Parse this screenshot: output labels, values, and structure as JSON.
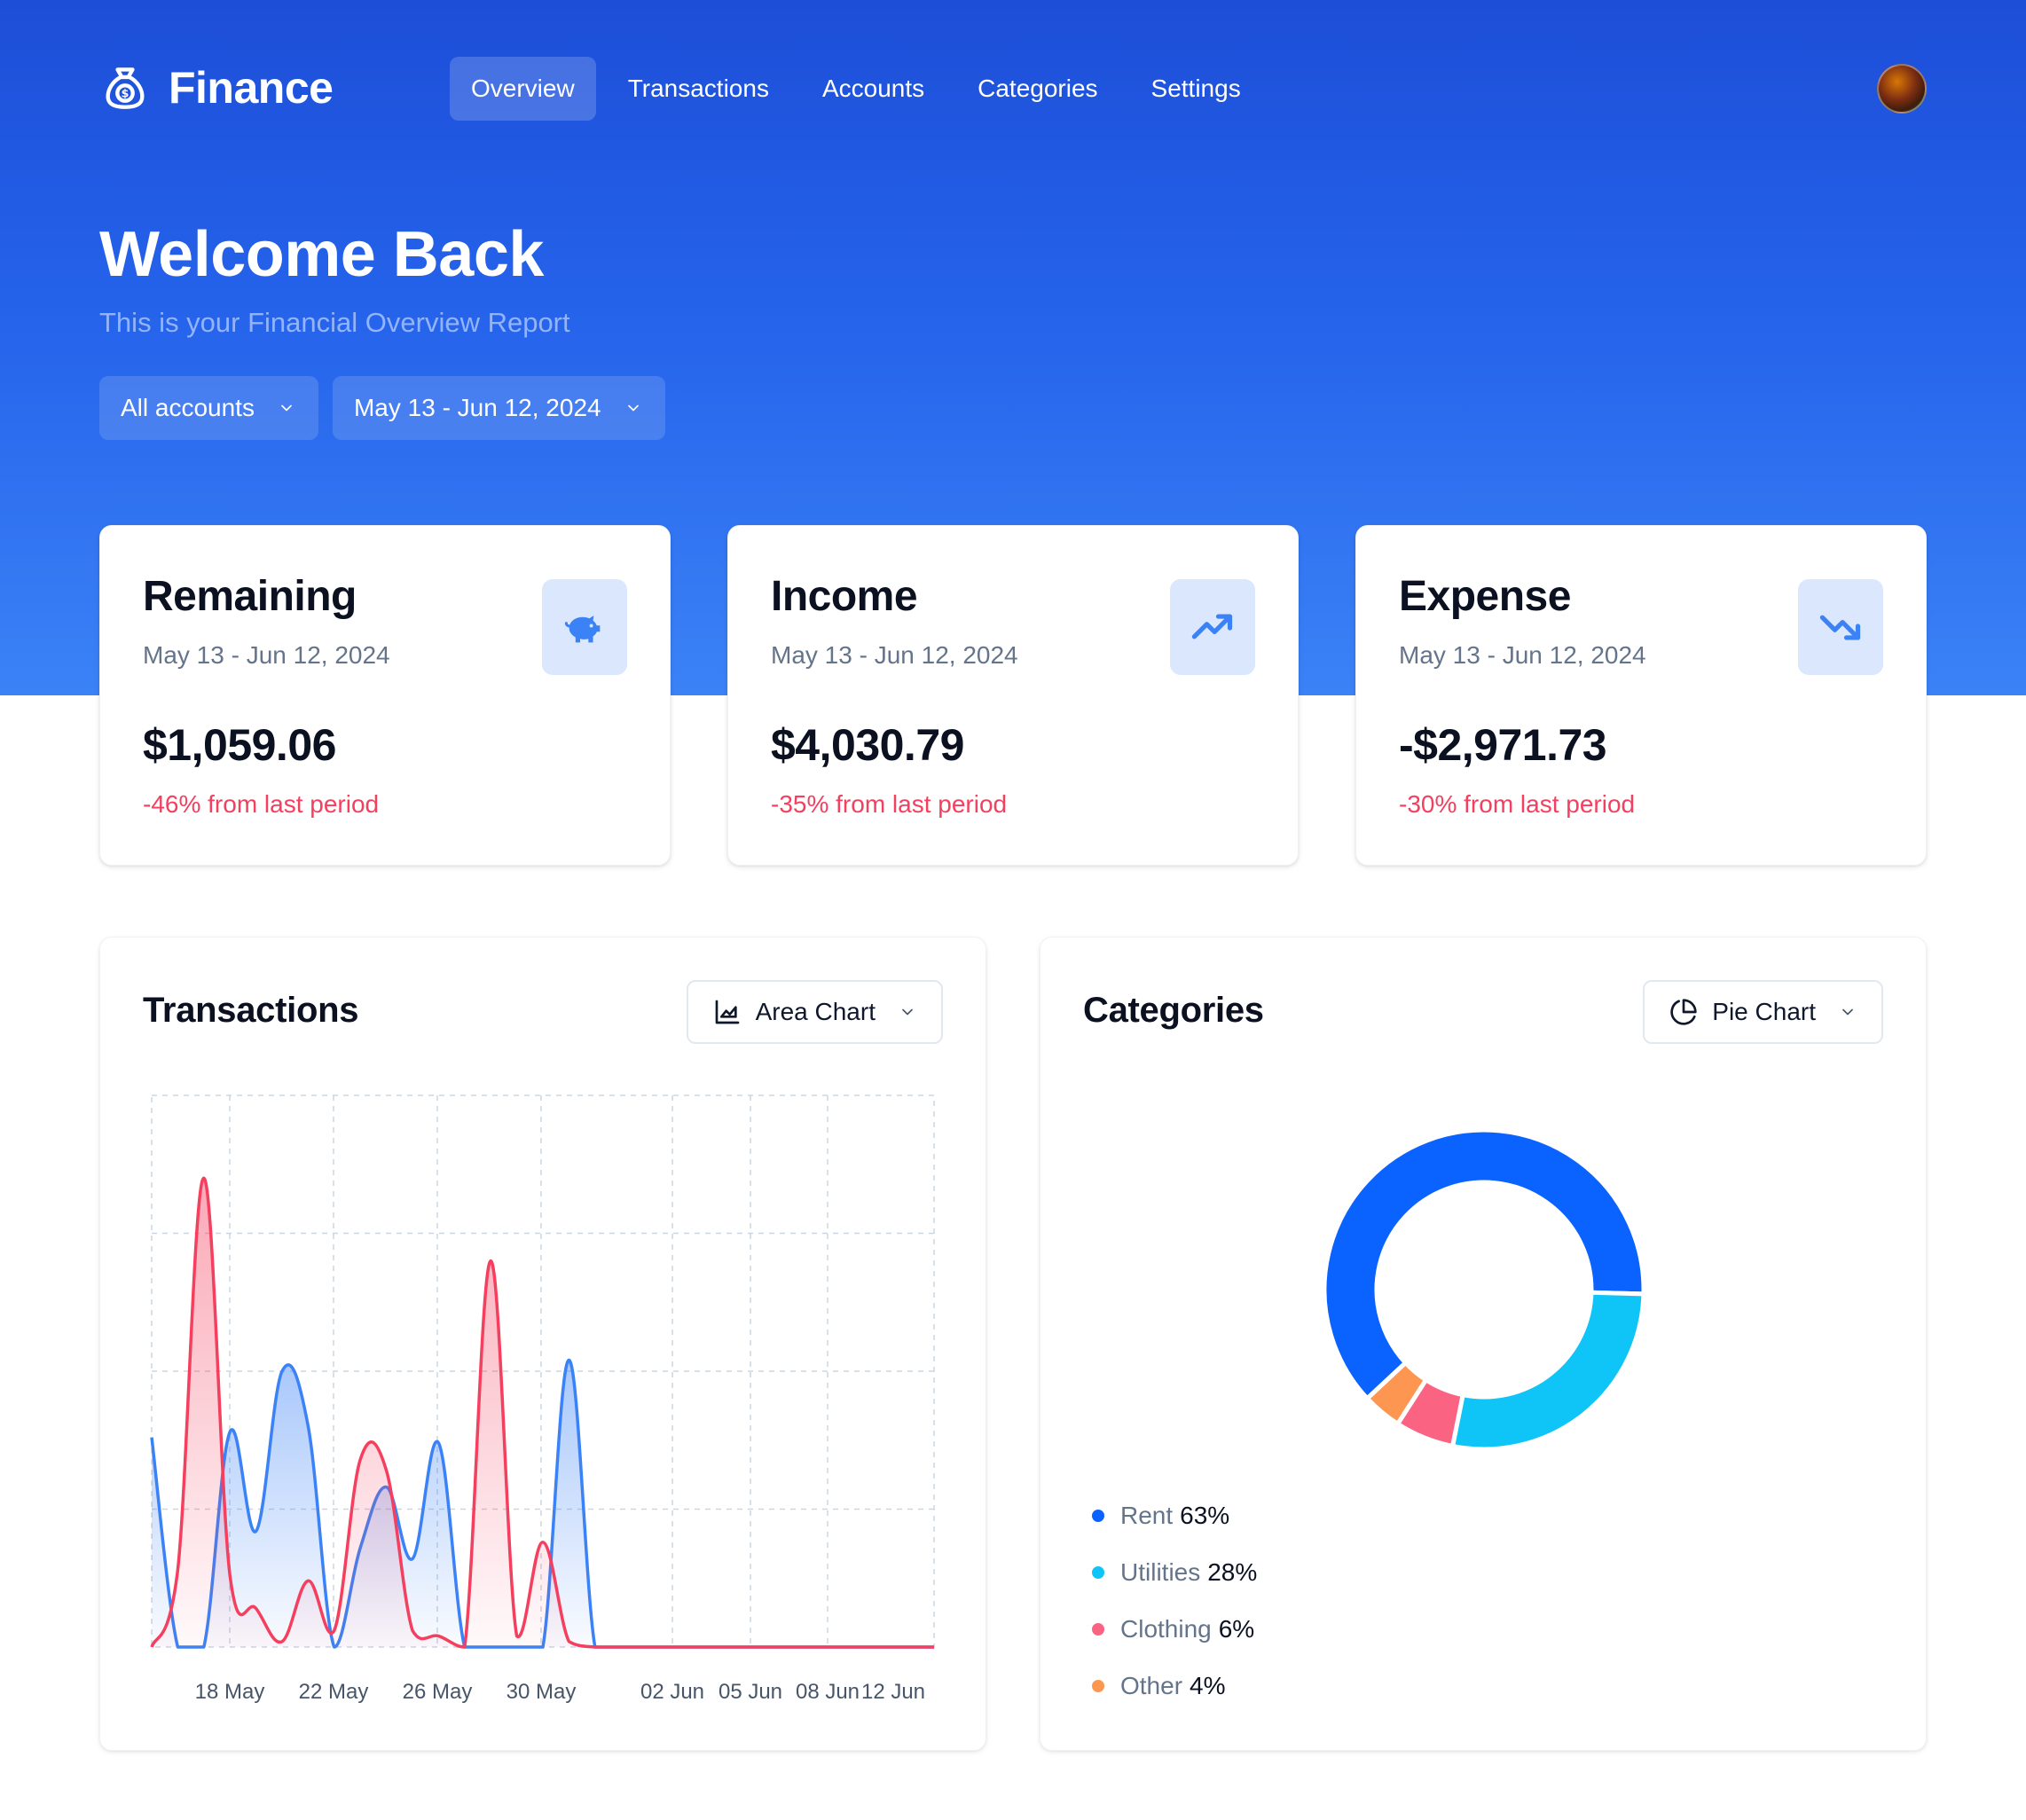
{
  "app": {
    "name": "Finance"
  },
  "nav": {
    "items": [
      {
        "label": "Overview",
        "active": true
      },
      {
        "label": "Transactions",
        "active": false
      },
      {
        "label": "Accounts",
        "active": false
      },
      {
        "label": "Categories",
        "active": false
      },
      {
        "label": "Settings",
        "active": false
      }
    ]
  },
  "hero": {
    "title": "Welcome Back",
    "subtitle": "This is your Financial Overview Report"
  },
  "filters": {
    "account": "All accounts",
    "date_range": "May 13 - Jun 12, 2024"
  },
  "cards": [
    {
      "title": "Remaining",
      "date": "May 13 - Jun 12, 2024",
      "amount": "$1,059.06",
      "change": "-46% from last period",
      "icon": "piggy-bank-icon"
    },
    {
      "title": "Income",
      "date": "May 13 - Jun 12, 2024",
      "amount": "$4,030.79",
      "change": "-35% from last period",
      "icon": "trending-up-icon"
    },
    {
      "title": "Expense",
      "date": "May 13 - Jun 12, 2024",
      "amount": "-$2,971.73",
      "change": "-30% from last period",
      "icon": "trending-down-icon"
    }
  ],
  "transactions_panel": {
    "title": "Transactions",
    "chart_type_label": "Area Chart"
  },
  "categories_panel": {
    "title": "Categories",
    "chart_type_label": "Pie Chart"
  },
  "colors": {
    "brand": "#2563eb",
    "income": "#3b82f6",
    "expense": "#f43f5e",
    "rent": "#0a62ff",
    "utilities": "#0fc5f8",
    "clothing": "#fb6383",
    "other": "#fd9651"
  },
  "chart_data": [
    {
      "type": "area",
      "title": "",
      "x_ticks": [
        "18 May",
        "22 May",
        "26 May",
        "30 May",
        "02 Jun",
        "05 Jun",
        "08 Jun",
        "12 Jun"
      ],
      "x": [
        "13 May",
        "14 May",
        "15 May",
        "16 May",
        "17 May",
        "18 May",
        "19 May",
        "20 May",
        "21 May",
        "22 May",
        "23 May",
        "24 May",
        "25 May",
        "26 May",
        "27 May",
        "28 May",
        "29 May",
        "30 May",
        "31 May",
        "01 Jun",
        "02 Jun",
        "03 Jun",
        "04 Jun",
        "05 Jun",
        "06 Jun",
        "07 Jun",
        "08 Jun",
        "09 Jun",
        "10 Jun",
        "11 Jun",
        "12 Jun"
      ],
      "y_gridlines": 4,
      "series": [
        {
          "name": "",
          "color": "#3b82f6",
          "values": [
            0.38,
            0.0,
            0.0,
            0.39,
            0.21,
            0.5,
            0.4,
            0.0,
            0.18,
            0.29,
            0.16,
            0.37,
            0.0,
            0.0,
            0.0,
            0.0,
            0.52,
            0.0,
            0.0,
            0.0,
            0.0,
            0.0,
            0.0,
            0.0,
            0.0,
            0.0,
            0.0,
            0.0,
            0.0,
            0.0,
            0.0
          ]
        },
        {
          "name": "",
          "color": "#f43f5e",
          "values": [
            0.0,
            0.14,
            0.85,
            0.13,
            0.07,
            0.01,
            0.12,
            0.03,
            0.34,
            0.32,
            0.03,
            0.02,
            0.0,
            0.7,
            0.02,
            0.19,
            0.01,
            0.0,
            0.0,
            0.0,
            0.0,
            0.0,
            0.0,
            0.0,
            0.0,
            0.0,
            0.0,
            0.0,
            0.0,
            0.0,
            0.0
          ]
        }
      ]
    },
    {
      "type": "pie",
      "title": "",
      "donut": true,
      "series": [
        {
          "name": "Rent",
          "value": 63,
          "label": "63%",
          "color": "#0a62ff"
        },
        {
          "name": "Utilities",
          "value": 28,
          "label": "28%",
          "color": "#0fc5f8"
        },
        {
          "name": "Clothing",
          "value": 6,
          "label": "6%",
          "color": "#fb6383"
        },
        {
          "name": "Other",
          "value": 4,
          "label": "4%",
          "color": "#fd9651"
        }
      ]
    }
  ]
}
